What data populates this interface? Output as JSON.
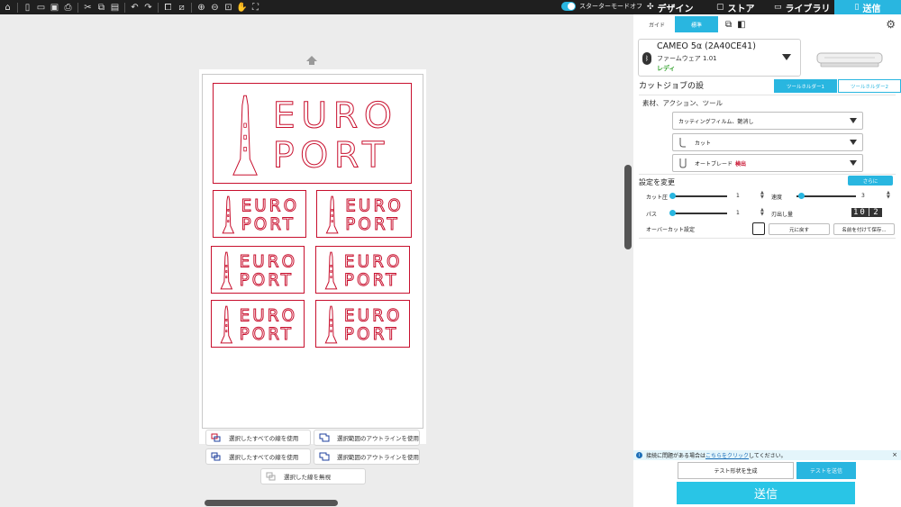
{
  "toolbar": {
    "icons": [
      "home-icon",
      "new-file-icon",
      "open-folder-icon",
      "save-icon",
      "print-icon",
      "cut-icon",
      "copy-icon",
      "paste-icon",
      "undo-icon",
      "redo-icon",
      "group-icon",
      "ungroup-icon",
      "zoom-in-icon",
      "zoom-out-icon",
      "zoom-fit-icon",
      "pan-icon",
      "fullscreen-icon"
    ],
    "mode_label": "スターターモードオフ",
    "tabs": [
      {
        "label": "デザイン",
        "icon": "design-icon"
      },
      {
        "label": "ストア",
        "icon": "store-icon"
      },
      {
        "label": "ライブラリ",
        "icon": "folder-icon"
      },
      {
        "label": "送信",
        "icon": "send-icon"
      }
    ]
  },
  "canvas": {
    "logo_line1": "EURO",
    "logo_line2": "PORT",
    "buttons": {
      "use_all_lines_1": "選択したすべての線を使用",
      "use_outline_1": "選択範囲のアウトラインを使用",
      "use_all_lines_2": "選択したすべての線を使用",
      "use_outline_2": "選択範囲のアウトラインを使用",
      "ignore_selected": "選択した線を無視"
    }
  },
  "panel": {
    "tabs": {
      "guide": "ガイド",
      "standard": "標準"
    },
    "device": {
      "name": "CAMEO 5α (2A40CE41)",
      "firmware": "ファームウェア 1.01",
      "status": "レディ"
    },
    "cutjob": {
      "title": "カットジョブの設",
      "tool_holder_1": "ツールホルダー1",
      "tool_holder_2": "ツールホルダー2",
      "subhead": "素材、アクション、ツール",
      "material": "カッティングフィルム、艶消し",
      "action": "カット",
      "tool": "オートブレード",
      "tool_detect": "検出"
    },
    "settings": {
      "title": "設定を変更",
      "more_button": "さらに",
      "cut_pressure_label": "カット圧",
      "cut_pressure_value": "1",
      "speed_label": "速度",
      "speed_value": "3",
      "passes_label": "パス",
      "passes_value": "1",
      "blade_label": "刃出し量",
      "blade_value": "10|2",
      "overcut_label": "オーバーカット設定",
      "reset_button": "元に戻す",
      "save_as_button": "名前を付けて保存..."
    },
    "info": {
      "prefix": "接続に問題がある場合は",
      "link": "こちらをクリック",
      "suffix": "してください。"
    },
    "test_generate": "テスト形状を生成",
    "test_send": "テストを送信",
    "send_button": "送信"
  },
  "colors": {
    "accent": "#29b6e0",
    "logo": "#c8102e",
    "dark_bar": "#1f1f1f"
  }
}
